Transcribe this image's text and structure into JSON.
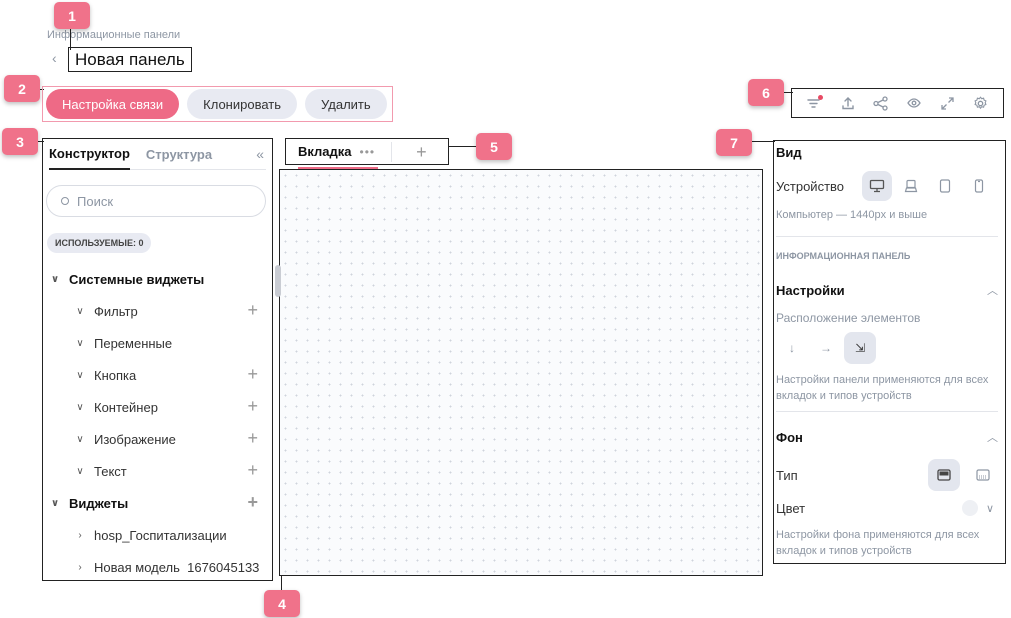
{
  "header": {
    "breadcrumb": "Информационные панели",
    "title": "Новая панель"
  },
  "actions": {
    "connection_settings": "Настройка связи",
    "clone": "Клонировать",
    "delete": "Удалить"
  },
  "callouts": [
    "1",
    "2",
    "3",
    "4",
    "5",
    "6",
    "7"
  ],
  "left_panel": {
    "tabs": [
      "Конструктор",
      "Структура"
    ],
    "search_placeholder": "Поиск",
    "used_badge": "ИСПОЛЬЗУЕМЫЕ: 0",
    "system_widgets_title": "Системные виджеты",
    "system_widgets": [
      "Фильтр",
      "Переменные",
      "Кнопка",
      "Контейнер",
      "Изображение",
      "Текст"
    ],
    "widgets_title": "Виджеты",
    "widgets": [
      "hosp_Госпитализации",
      "Новая модель  1676045133"
    ]
  },
  "canvas": {
    "tab_label": "Вкладка"
  },
  "right_panel": {
    "view_title": "Вид",
    "device_label": "Устройство",
    "device_hint": "Компьютер — 1440px и выше",
    "section_caps": "ИНФОРМАЦИОННАЯ ПАНЕЛЬ",
    "settings_title": "Настройки",
    "layout_label": "Расположение элементов",
    "settings_hint": "Настройки панели применяются для всех вкладок и типов устройств",
    "background_title": "Фон",
    "type_label": "Тип",
    "color_label": "Цвет",
    "background_hint": "Настройки фона применяются для всех вкладок и типов устройств"
  },
  "colors": {
    "accent": "#ee6a86",
    "callout": "#f0728a",
    "muted_text": "#8d96a3"
  }
}
